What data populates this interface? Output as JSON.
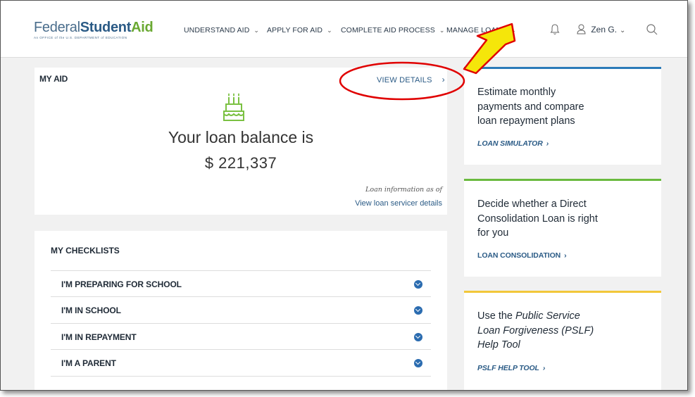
{
  "header": {
    "logo": {
      "word1": "Federal",
      "word2": "Student",
      "word3": "Aid",
      "subtitle": "An OFFICE of the U.S. DEPARTMENT of EDUCATION"
    },
    "nav": [
      {
        "label": "UNDERSTAND AID",
        "chevron": "⌄"
      },
      {
        "label": "APPLY FOR AID",
        "chevron": "⌄"
      },
      {
        "label": "COMPLETE AID PROCESS",
        "chevron": "⌄"
      },
      {
        "label": "MANAGE LOANS",
        "chevron": "⌄"
      }
    ],
    "user_name": "Zen G.",
    "user_chevron": "⌄"
  },
  "my_aid": {
    "title": "MY AID",
    "view_details": "VIEW DETAILS",
    "view_details_arrow": "›",
    "balance_label": "Your loan balance is",
    "balance_value": "$ 221,337",
    "loan_info": "Loan information as of",
    "servicer_link": "View loan servicer details"
  },
  "checklists": {
    "title": "MY CHECKLISTS",
    "items": [
      {
        "label": "I'M PREPARING FOR SCHOOL"
      },
      {
        "label": "I'M IN SCHOOL"
      },
      {
        "label": "I'M IN REPAYMENT"
      },
      {
        "label": "I'M A PARENT"
      }
    ]
  },
  "sidebar_cards": [
    {
      "lines": [
        "Estimate monthly",
        "payments and compare",
        "loan repayment plans"
      ],
      "link": "LOAN SIMULATOR",
      "link_arrow": "›",
      "accent": "#2b7ab8"
    },
    {
      "lines": [
        "Decide whether a Direct",
        "Consolidation Loan is right",
        "for you"
      ],
      "link": "LOAN CONSOLIDATION",
      "link_arrow": "›",
      "accent": "#6aba3e"
    },
    {
      "line1_prefix": "Use the ",
      "line1_em": "Public Service",
      "line2": "Loan Forgiveness (PSLF)",
      "line3": "Help Tool",
      "link": "PSLF HELP TOOL",
      "link_arrow": "›",
      "accent": "#f2c73a"
    }
  ],
  "colors": {
    "annotation_red": "#e00000",
    "annotation_arrow": "#f5e60a",
    "link_blue": "#2b5b86",
    "brand_green": "#6aa932"
  },
  "icons": {
    "cake": "birthday-cake-icon",
    "bell": "bell-icon",
    "user": "user-icon",
    "search": "search-icon",
    "toggle": "chevron-down-circle-icon"
  }
}
